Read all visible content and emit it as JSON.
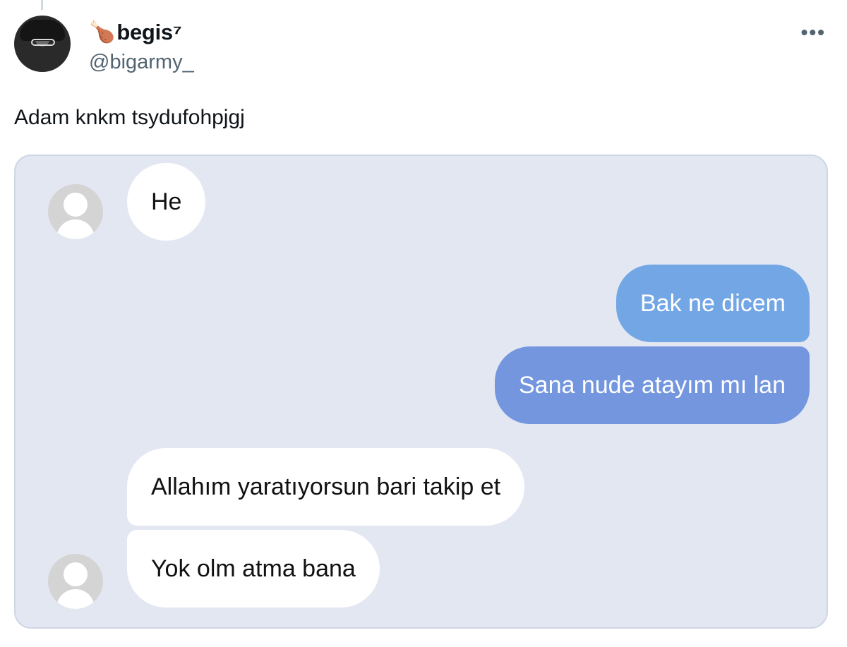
{
  "tweet": {
    "author": {
      "emoji": "🍗",
      "display_name": "begis⁷",
      "handle": "@bigarmy_"
    },
    "more_icon": "more-horizontal-icon",
    "text": "Adam knkm tsydufohpjgj"
  },
  "chat": {
    "messages": [
      {
        "side": "incoming",
        "text": "He"
      },
      {
        "side": "outgoing",
        "text": "Bak ne dicem"
      },
      {
        "side": "outgoing",
        "text": "Sana nude atayım mı lan"
      },
      {
        "side": "incoming",
        "text": "Allahım yaratıyorsun bari takip et"
      },
      {
        "side": "incoming",
        "text": "Yok olm atma bana"
      }
    ],
    "colors": {
      "background": "#e3e7f2",
      "outgoing_top": "#73a6e5",
      "outgoing_bottom": "#7396df",
      "incoming": "#ffffff"
    }
  }
}
